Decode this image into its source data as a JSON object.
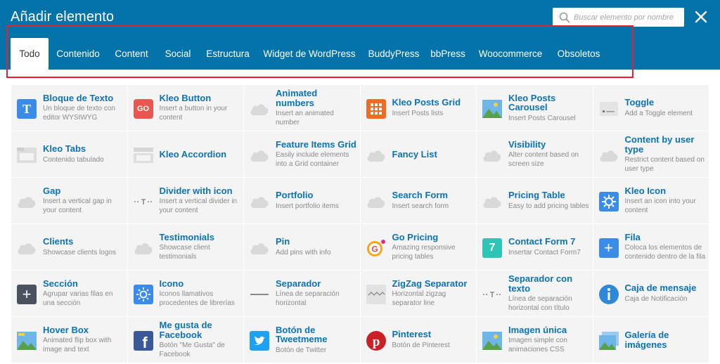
{
  "header": {
    "title": "Añadir elemento",
    "search_placeholder": "Buscar elemento por nombre",
    "close_icon": "close-icon"
  },
  "tabs": [
    {
      "label": "Todo",
      "active": true
    },
    {
      "label": "Contenido"
    },
    {
      "label": "Content"
    },
    {
      "label": "Social"
    },
    {
      "label": "Estructura"
    },
    {
      "label": "Widget de WordPress"
    },
    {
      "label": "BuddyPress"
    },
    {
      "label": "bbPress"
    },
    {
      "label": "Woocommerce"
    },
    {
      "label": "Obsoletos"
    }
  ],
  "elements": [
    {
      "name": "Bloque de Texto",
      "desc": "Un bloque de texto con editor WYSIWYG",
      "icon": "text-block-icon"
    },
    {
      "name": "Kleo Button",
      "desc": "Insert a button in your content",
      "icon": "go-button-icon"
    },
    {
      "name": "Animated numbers",
      "desc": "Insert an animated number",
      "icon": "cloud-icon"
    },
    {
      "name": "Kleo Posts Grid",
      "desc": "Insert Posts lists",
      "icon": "posts-grid-icon"
    },
    {
      "name": "Kleo Posts Carousel",
      "desc": "Insert Posts Carousel",
      "icon": "image-icon"
    },
    {
      "name": "Toggle",
      "desc": "Add a Toggle element",
      "icon": "toggle-icon"
    },
    {
      "name": "Kleo Tabs",
      "desc": "Contenido tabulado",
      "icon": "tabs-icon"
    },
    {
      "name": "Kleo Accordion",
      "desc": "",
      "icon": "accordion-icon"
    },
    {
      "name": "Feature Items Grid",
      "desc": "Easily include elements into a Grid container",
      "icon": "cloud-icon"
    },
    {
      "name": "Fancy List",
      "desc": "",
      "icon": "cloud-icon"
    },
    {
      "name": "Visibility",
      "desc": "Alter content based on screen size",
      "icon": "cloud-icon"
    },
    {
      "name": "Content by user type",
      "desc": "Restrict content based on user type",
      "icon": "cloud-icon"
    },
    {
      "name": "Gap",
      "desc": "Insert a vertical gap in your content",
      "icon": "cloud-icon"
    },
    {
      "name": "Divider with icon",
      "desc": "Insert a vertical divider in your content",
      "icon": "divider-icon"
    },
    {
      "name": "Portfolio",
      "desc": "Insert portfolio items",
      "icon": "cloud-icon"
    },
    {
      "name": "Search Form",
      "desc": "Insert search form",
      "icon": "cloud-icon"
    },
    {
      "name": "Pricing Table",
      "desc": "Easy to add pricing tables",
      "icon": "cloud-icon"
    },
    {
      "name": "Kleo Icon",
      "desc": "Insert an icon into your content",
      "icon": "gear-icon"
    },
    {
      "name": "Clients",
      "desc": "Showcase clients logos",
      "icon": "cloud-icon"
    },
    {
      "name": "Testimonials",
      "desc": "Showcase client testimonials",
      "icon": "cloud-icon"
    },
    {
      "name": "Pin",
      "desc": "Add pins with info",
      "icon": "cloud-icon"
    },
    {
      "name": "Go Pricing",
      "desc": "Amazing responsive pricing tables",
      "icon": "go-pricing-icon"
    },
    {
      "name": "Contact Form 7",
      "desc": "Insertar Contact Form7",
      "icon": "contact-form-icon"
    },
    {
      "name": "Fila",
      "desc": "Coloca los elementos de contenido dentro de la fila",
      "icon": "plus-blue-icon"
    },
    {
      "name": "Sección",
      "desc": "Agrupar varias filas en una sección",
      "icon": "plus-dark-icon"
    },
    {
      "name": "Icono",
      "desc": "Iconos llamativos procedentes de librerías",
      "icon": "sun-icon"
    },
    {
      "name": "Separador",
      "desc": "Línea de separación horizontal",
      "icon": "separator-icon"
    },
    {
      "name": "ZigZag Separator",
      "desc": "Horizontal zigzag separator line",
      "icon": "zigzag-icon"
    },
    {
      "name": "Separador con texto",
      "desc": "Línea de separación horizontal con título",
      "icon": "divider-icon"
    },
    {
      "name": "Caja de mensaje",
      "desc": "Caja de Notificación",
      "icon": "info-icon"
    },
    {
      "name": "Hover Box",
      "desc": "Animated flip box with image and text",
      "icon": "hover-box-icon"
    },
    {
      "name": "Me gusta de Facebook",
      "desc": "Botón \"Me Gusta\" de Facebook",
      "icon": "facebook-icon"
    },
    {
      "name": "Botón de Tweetmeme",
      "desc": "Botón de Twitter",
      "icon": "twitter-icon"
    },
    {
      "name": "Pinterest",
      "desc": "Botón de Pinterest",
      "icon": "pinterest-icon"
    },
    {
      "name": "Imagen única",
      "desc": "Imagen simple con animaciones CSS",
      "icon": "image-icon"
    },
    {
      "name": "Galería de imágenes",
      "desc": "",
      "icon": "gallery-icon"
    }
  ],
  "colors": {
    "header": "#0473aa",
    "highlight": "#e8202e",
    "element_name": "#0b73b5"
  }
}
